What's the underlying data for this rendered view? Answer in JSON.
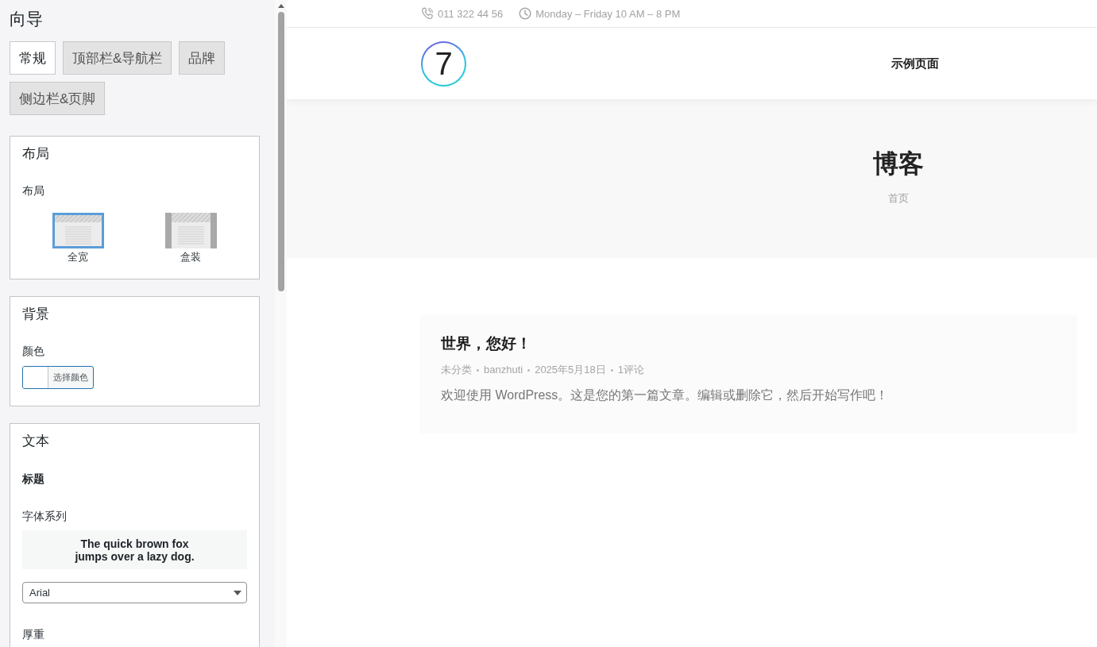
{
  "sidebar": {
    "title": "向导",
    "tabs": [
      {
        "label": "常规",
        "selected": true
      },
      {
        "label": "顶部栏&导航栏",
        "selected": false
      },
      {
        "label": "品牌",
        "selected": false
      },
      {
        "label": "侧边栏&页脚",
        "selected": false
      }
    ],
    "layout_section": {
      "heading": "布局",
      "label": "布局",
      "options": [
        {
          "kind": "full-width",
          "label": "全宽",
          "selected": true
        },
        {
          "kind": "boxed",
          "label": "盒装",
          "selected": false
        }
      ]
    },
    "background_section": {
      "heading": "背景",
      "label": "颜色",
      "color_button": "选择颜色"
    },
    "text_section": {
      "heading": "文本",
      "subheading": "标题",
      "font_family_label": "字体系列",
      "font_preview": "The quick brown fox jumps over a lazy dog.",
      "font_family_select": "Arial",
      "weight_label": "厚重"
    }
  },
  "preview": {
    "top_bar": {
      "phone": "011 322 44 56",
      "hours": "Monday – Friday 10 AM – 8 PM"
    },
    "header": {
      "logo": "7",
      "nav": [
        {
          "label": "示例页面"
        }
      ]
    },
    "hero": {
      "title": "博客",
      "breadcrumb": "首页"
    },
    "posts": [
      {
        "title": "世界，您好！",
        "meta": [
          "未分类",
          "banzhuti",
          "2025年5月18日",
          "1评论"
        ],
        "excerpt": "欢迎使用 WordPress。这是您的第一篇文章。编辑或删除它，然后开始写作吧！"
      }
    ]
  }
}
